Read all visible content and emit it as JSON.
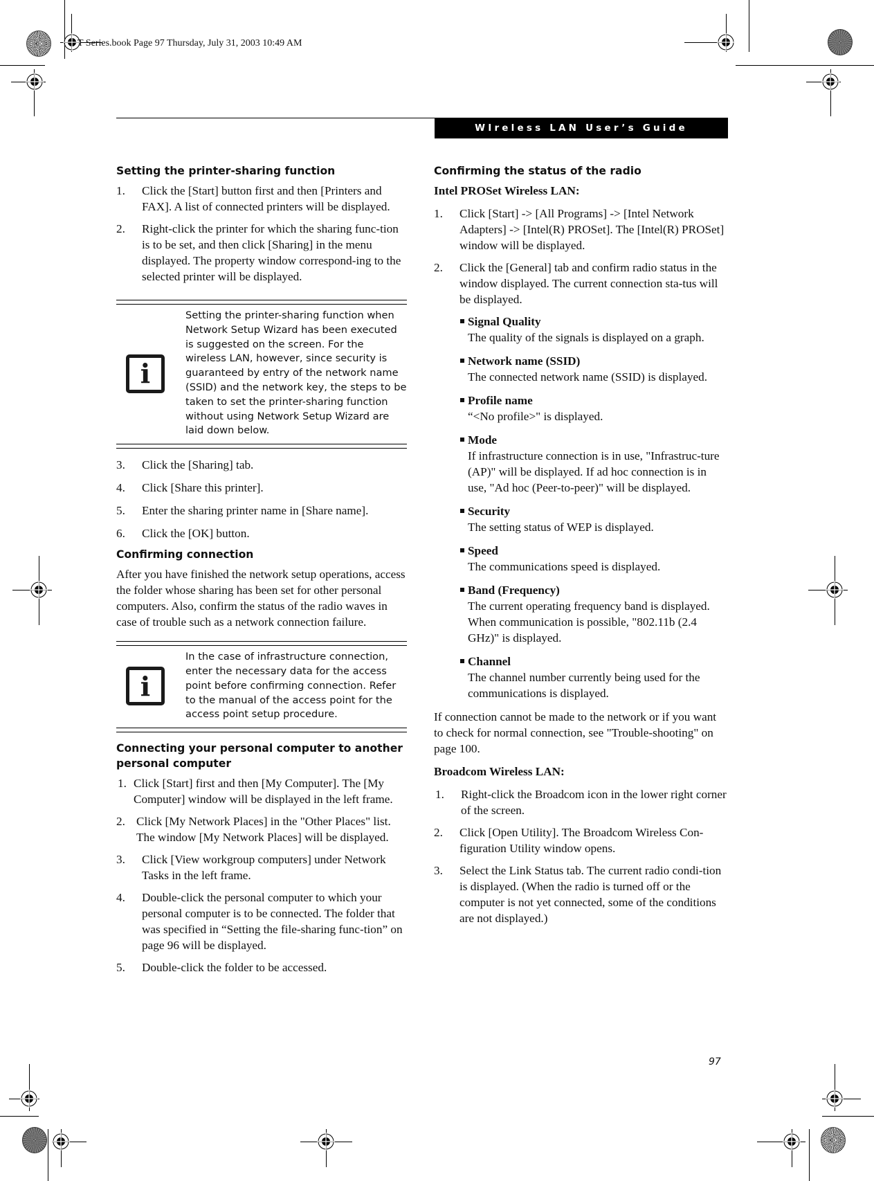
{
  "slug": "T Series.book  Page 97  Thursday, July 31, 2003  10:49 AM",
  "header": {
    "title": "WIreless LAN User’s Guide"
  },
  "left": {
    "printer": {
      "heading": "Setting the printer-sharing function",
      "steps_a": [
        {
          "num": "1.",
          "text": "Click the [Start] button first and then [Printers and FAX]. A list of connected printers will be displayed."
        },
        {
          "num": "2.",
          "text": "Right-click the printer for which the sharing func-tion is to be set, and then click [Sharing] in the menu displayed. The property window correspond-ing to the selected printer will be displayed."
        }
      ],
      "note": "Setting the printer-sharing function when Network Setup Wizard has been executed is suggested on the screen. For the wireless LAN, however, since security is guaranteed by entry of the network name (SSID) and the network key, the steps to be taken to set the printer-sharing function without using Network Setup Wizard are laid down below.",
      "steps_b": [
        {
          "num": "3.",
          "text": "Click the [Sharing] tab."
        },
        {
          "num": "4.",
          "text": "Click [Share this printer]."
        },
        {
          "num": "5.",
          "text": "Enter the sharing printer name in [Share name]."
        },
        {
          "num": "6.",
          "text": "Click the [OK] button."
        }
      ]
    },
    "confirm": {
      "heading": "Confirming connection",
      "body": "After you have finished the network setup operations, access the folder whose sharing has been set for other personal computers. Also, confirm the status of the radio waves in case of trouble such as a network connection failure.",
      "note": "In the case of infrastructure connection, enter the necessary data for the access point before confirming connection. Refer to the manual of the access point for the access point setup procedure."
    },
    "connecting": {
      "heading": "Connecting your personal computer to another personal computer",
      "steps": [
        {
          "num": "1.",
          "text": "Click [Start] first and then [My Computer]. The [My Computer] window will be displayed in the left frame."
        },
        {
          "num": "2.",
          "text": "Click [My Network Places] in the \"Other Places\" list. The window [My Network Places] will be displayed."
        },
        {
          "num": "3.",
          "text": "Click [View workgroup computers] under Network Tasks in the left frame."
        },
        {
          "num": "4.",
          "text": "Double-click the personal computer to which your personal computer is to be connected. The folder that was specified in “Setting the file-sharing func-tion” on page 96 will be displayed."
        },
        {
          "num": "5.",
          "text": "Double-click the folder to be accessed."
        }
      ]
    }
  },
  "right": {
    "heading": "Confirming the status of the radio",
    "intel": {
      "label": "Intel PROSet Wireless LAN:",
      "steps": [
        {
          "num": "1.",
          "text": "Click [Start] -> [All Programs] -> [Intel Network Adapters] -> [Intel(R) PROSet]. The [Intel(R) PROSet] window will be displayed."
        },
        {
          "num": "2.",
          "text": "Click the [General] tab and confirm radio status in the window displayed. The current connection sta-tus will be displayed."
        }
      ],
      "items": [
        {
          "title": "Signal Quality",
          "desc": "The quality of the signals is displayed on a graph."
        },
        {
          "title": "Network name (SSID)",
          "desc": "The connected network name (SSID) is displayed."
        },
        {
          "title": "Profile name",
          "desc": "“<No profile>\" is displayed."
        },
        {
          "title": "Mode",
          "desc": "If infrastructure connection is in use, \"Infrastruc-ture (AP)\" will be displayed. If ad hoc connection is in use, \"Ad hoc (Peer-to-peer)\" will be displayed."
        },
        {
          "title": "Security",
          "desc": "The setting status of WEP is displayed."
        },
        {
          "title": "Speed",
          "desc": "The communications speed is displayed."
        },
        {
          "title": "Band (Frequency)",
          "desc": "The current operating frequency band is displayed. When communication is possible, \"802.11b (2.4 GHz)\" is displayed."
        },
        {
          "title": "Channel",
          "desc": "The channel number currently being used for the communications is displayed."
        }
      ],
      "after": "If connection cannot be made to the network or if you want to check for normal connection, see \"Trouble-shooting\" on page 100."
    },
    "broadcom": {
      "label": "Broadcom Wireless LAN:",
      "steps": [
        {
          "num": "1.",
          "text": "Right-click the Broadcom icon in the lower right corner of the screen."
        },
        {
          "num": "2.",
          "text": "Click [Open Utility]. The Broadcom Wireless Con-figuration Utility window opens."
        },
        {
          "num": "3.",
          "text": "Select the Link Status tab. The current radio condi-tion is displayed. (When the radio is turned off or the computer is not yet connected, some of the conditions are not displayed.)"
        }
      ]
    }
  },
  "page_number": "97"
}
